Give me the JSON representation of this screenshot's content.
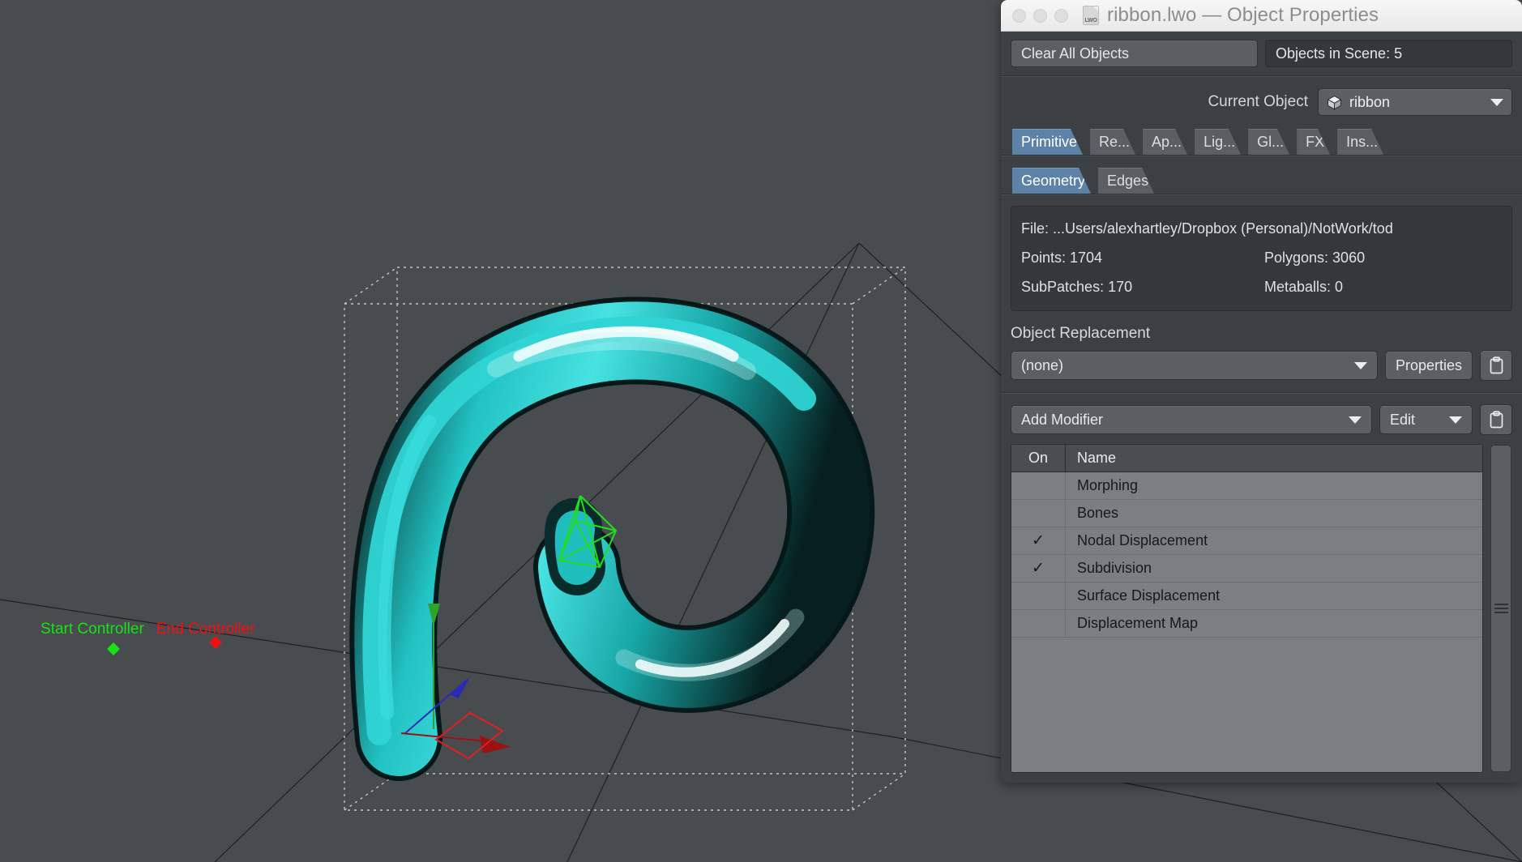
{
  "window": {
    "title": "ribbon.lwo — Object Properties",
    "file_icon_label": "LWO",
    "traffic_lights": [
      "close",
      "minimize",
      "zoom"
    ]
  },
  "toolbar": {
    "clear_all_objects": "Clear All Objects",
    "objects_in_scene": "Objects in Scene: 5"
  },
  "current_object": {
    "label": "Current Object",
    "value": "ribbon",
    "icon": "cube-icon"
  },
  "tabs": [
    {
      "label": "Primitive",
      "active": true
    },
    {
      "label": "Re...",
      "active": false
    },
    {
      "label": "Ap...",
      "active": false
    },
    {
      "label": "Lig...",
      "active": false
    },
    {
      "label": "Gl...",
      "active": false
    },
    {
      "label": "FX",
      "active": false
    },
    {
      "label": "Ins...",
      "active": false
    }
  ],
  "subtabs": [
    {
      "label": "Geometry",
      "active": true
    },
    {
      "label": "Edges",
      "active": false
    }
  ],
  "info": {
    "file": "File: ...Users/alexhartley/Dropbox (Personal)/NotWork/tod",
    "points": "Points: 1704",
    "polygons": "Polygons: 3060",
    "subpatches": "SubPatches: 170",
    "metaballs": "Metaballs: 0"
  },
  "object_replacement": {
    "title": "Object Replacement",
    "selected": "(none)",
    "properties_button": "Properties",
    "clipboard_icon": "clipboard-icon"
  },
  "modifiers": {
    "add_label": "Add Modifier",
    "edit_label": "Edit",
    "clipboard_icon": "clipboard-icon",
    "columns": [
      "On",
      "Name"
    ],
    "rows": [
      {
        "on": "",
        "name": "Morphing"
      },
      {
        "on": "",
        "name": "Bones"
      },
      {
        "on": "✓",
        "name": "Nodal Displacement"
      },
      {
        "on": "✓",
        "name": "Subdivision"
      },
      {
        "on": "",
        "name": "Surface Displacement"
      },
      {
        "on": "",
        "name": "Displacement Map"
      }
    ]
  },
  "viewport": {
    "labels": {
      "start_controller": "Start Controller",
      "end_controller": "End Controller"
    },
    "colors": {
      "background": "#484c4f",
      "ribbon_teal": "#23c7c7",
      "ribbon_highlight": "#ffffff",
      "start_green": "#19e019",
      "end_red": "#ef1111",
      "axis_x_red": "#9b1212",
      "axis_y_green": "#2aa62a",
      "axis_z_blue": "#2b2bb5",
      "camera_green": "#22dd22",
      "bbox_dotted": "#c9c6ae"
    }
  }
}
